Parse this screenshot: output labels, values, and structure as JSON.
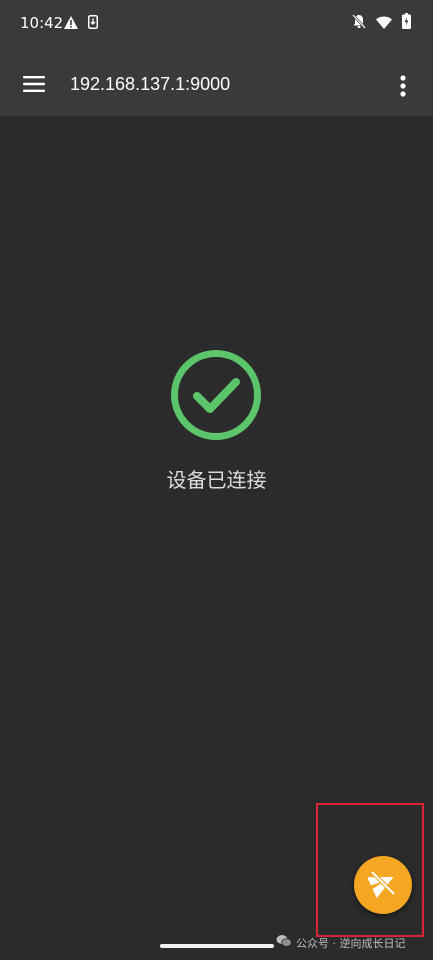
{
  "status_bar": {
    "time": "10:42",
    "left_icons": [
      "warning-icon",
      "screen-record-icon"
    ],
    "right_icons": [
      "notifications-off-icon",
      "wifi-icon",
      "battery-charging-icon"
    ]
  },
  "toolbar": {
    "title": "192.168.137.1:9000",
    "menu_icon": "hamburger-menu-icon",
    "more_icon": "more-vertical-icon"
  },
  "main": {
    "status_icon": "check-circle-icon",
    "status_text": "设备已连接",
    "status_color": "#5cc46a"
  },
  "fab": {
    "icon": "send-off-icon",
    "color": "#f5a623"
  },
  "highlight_color": "#d92636",
  "watermark": {
    "text": "公众号 · 逆向成长日记"
  }
}
